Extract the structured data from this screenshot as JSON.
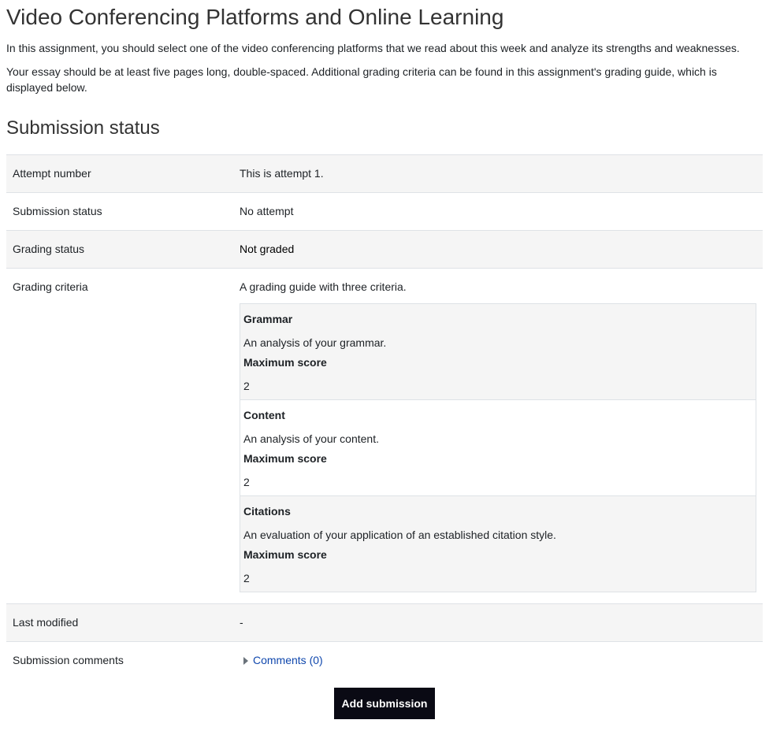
{
  "page": {
    "title": "Video Conferencing Platforms and Online Learning",
    "intro_1": "In this assignment, you should select one of the video conferencing platforms that we read about this week and analyze its strengths and weaknesses.",
    "intro_2": "Your essay should be at least five pages long, double-spaced.  Additional grading criteria can be found in this assignment's grading guide, which is displayed below."
  },
  "submission": {
    "heading": "Submission status",
    "rows": {
      "attempt": {
        "label": "Attempt number",
        "value": "This is attempt 1."
      },
      "status": {
        "label": "Submission status",
        "value": "No attempt"
      },
      "grading": {
        "label": "Grading status",
        "value": "Not graded"
      },
      "criteria": {
        "label": "Grading criteria",
        "value": "A grading guide with three criteria."
      },
      "modified": {
        "label": "Last modified",
        "value": "-"
      },
      "comments": {
        "label": "Submission comments",
        "link": "Comments (0)"
      }
    },
    "guide": [
      {
        "name": "Grammar",
        "description": "An analysis of your grammar.",
        "max_label": "Maximum score",
        "max_value": "2"
      },
      {
        "name": "Content",
        "description": "An analysis of your content.",
        "max_label": "Maximum score",
        "max_value": "2"
      },
      {
        "name": "Citations",
        "description": "An evaluation of your application of an established citation style.",
        "max_label": "Maximum score",
        "max_value": "2"
      }
    ],
    "button": "Add submission"
  }
}
